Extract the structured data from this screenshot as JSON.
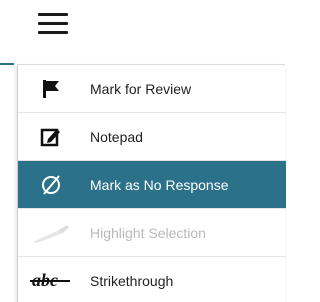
{
  "toolbar": {
    "menu_icon": "hamburger-menu-icon"
  },
  "menu": {
    "items": [
      {
        "label": "Mark for Review",
        "icon": "flag-icon",
        "state": "normal"
      },
      {
        "label": "Notepad",
        "icon": "notepad-icon",
        "state": "normal"
      },
      {
        "label": "Mark as No Response",
        "icon": "no-response-icon",
        "state": "selected"
      },
      {
        "label": "Highlight Selection",
        "icon": "highlighter-icon",
        "state": "disabled"
      },
      {
        "label": "Strikethrough",
        "icon": "strikethrough-icon",
        "icon_text": "abc",
        "state": "normal"
      }
    ]
  },
  "colors": {
    "accent": "#2b7189",
    "text": "#222222",
    "disabled_text": "#b9b9b9"
  }
}
